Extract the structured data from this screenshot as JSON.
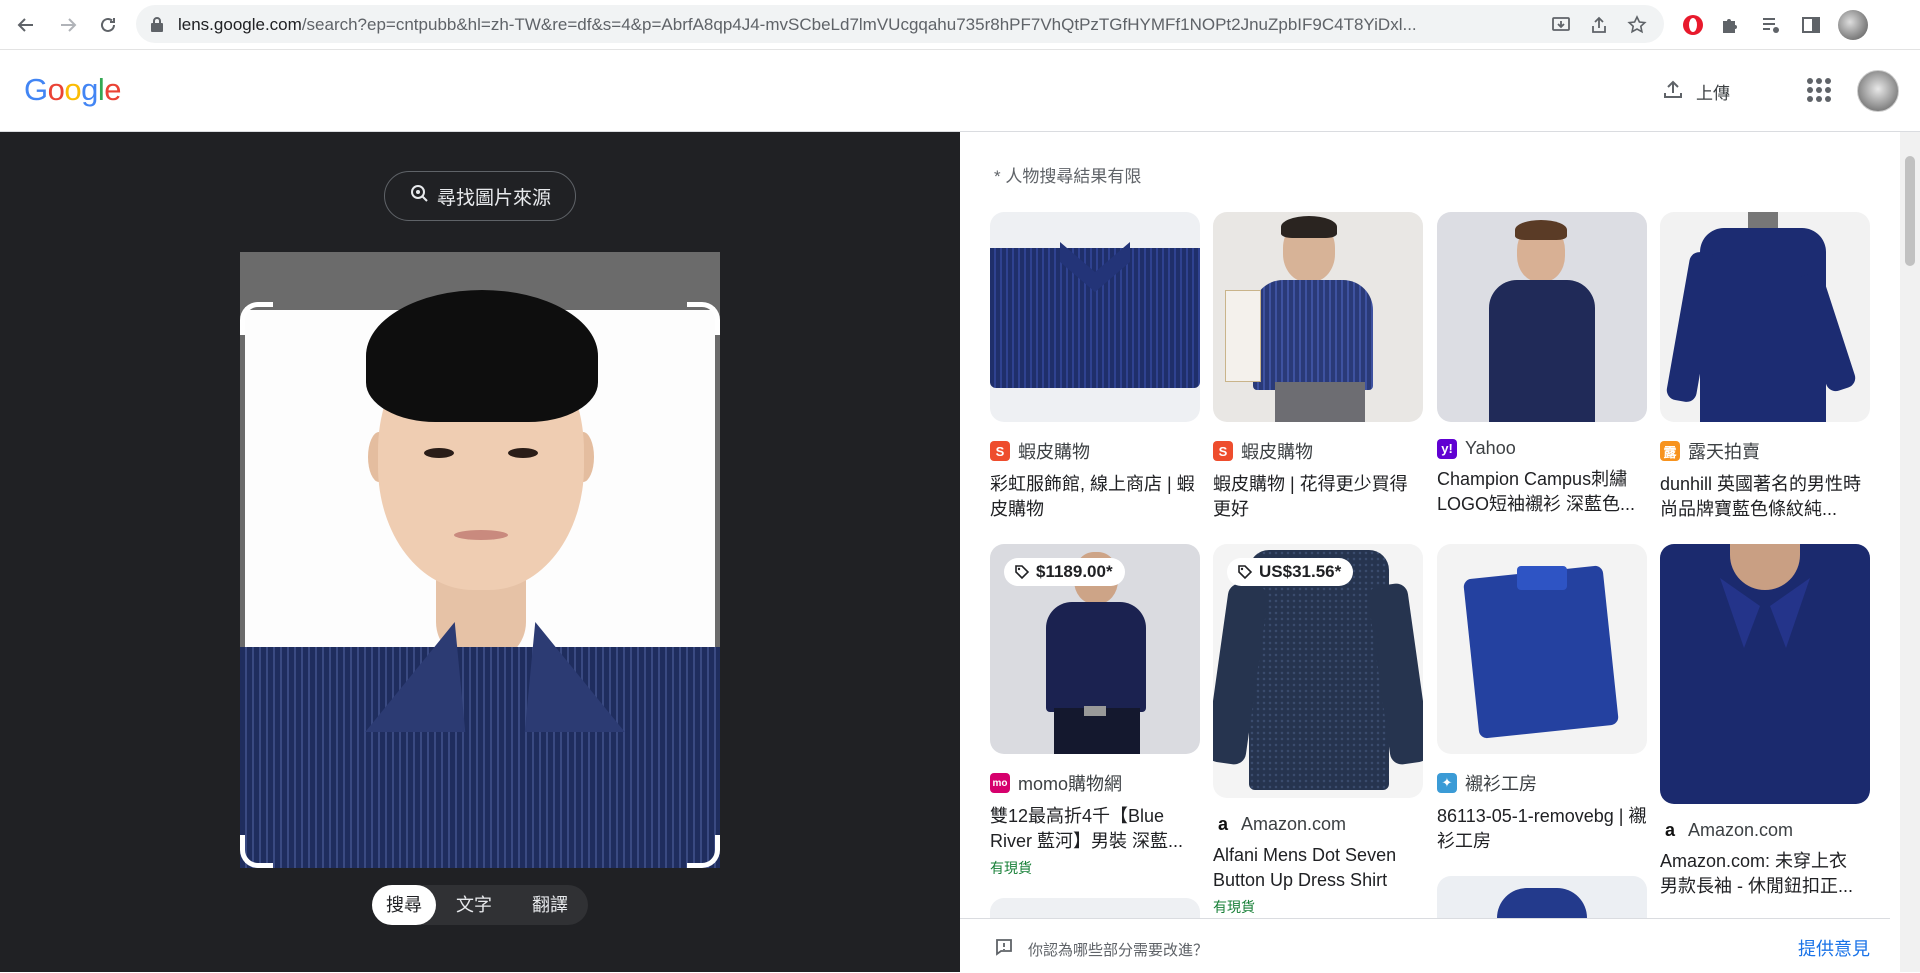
{
  "browser": {
    "url_host": "lens.google.com",
    "url_rest": "/search?ep=cntpubb&hl=zh-TW&re=df&s=4&p=AbrfA8qp4J4-mvSCbeLd7lmVUcgqahu735r8hPF7VhQtPzTGfHYMFf1NOPt2JnuZpbIF9C4T8YiDxl..."
  },
  "header": {
    "logo": "Google",
    "upload_label": "上傳"
  },
  "left": {
    "find_source_label": "尋找圖片來源",
    "modes": [
      "搜尋",
      "文字",
      "翻譯"
    ]
  },
  "results": {
    "note": "* 人物搜尋結果有限",
    "cards": [
      {
        "source": "蝦皮購物",
        "title": "彩虹服飾館, 線上商店 | 蝦皮購物",
        "favicon": "shopee"
      },
      {
        "source": "蝦皮購物",
        "title": "蝦皮購物 | 花得更少買得更好",
        "favicon": "shopee"
      },
      {
        "source": "Yahoo",
        "title": "Champion Campus刺繡LOGO短袖襯衫 深藍色...",
        "favicon": "yahoo"
      },
      {
        "source": "露天拍賣",
        "title": "dunhill 英國著名的男性時尚品牌寶藍色條紋純...",
        "favicon": "ruten"
      },
      {
        "source": "momo購物網",
        "title": "雙12最高折4千【Blue River 藍河】男裝 深藍...",
        "price": "$1189.00*",
        "stock": "有現貨",
        "favicon": "momo"
      },
      {
        "source": "Amazon.com",
        "title": "Alfani Mens Dot Seven Button Up Dress Shirt",
        "price": "US$31.56*",
        "stock": "有現貨",
        "favicon": "amazon"
      },
      {
        "source": "襯衫工房",
        "title": "86113-05-1-removebg | 襯衫工房",
        "favicon": "shirt"
      },
      {
        "source": "Amazon.com",
        "title": "Amazon.com: 未穿上衣 男款長袖 - 休閒鈕扣正...",
        "favicon": "amazon"
      }
    ],
    "feedback_question": "你認為哪些部分需要改進？",
    "feedback_link": "提供意見"
  },
  "colors": {
    "dark_panel": "#202124",
    "shirt_navy": "#1f2d5e",
    "link_blue": "#1a73e8",
    "stock_green": "#188038"
  }
}
